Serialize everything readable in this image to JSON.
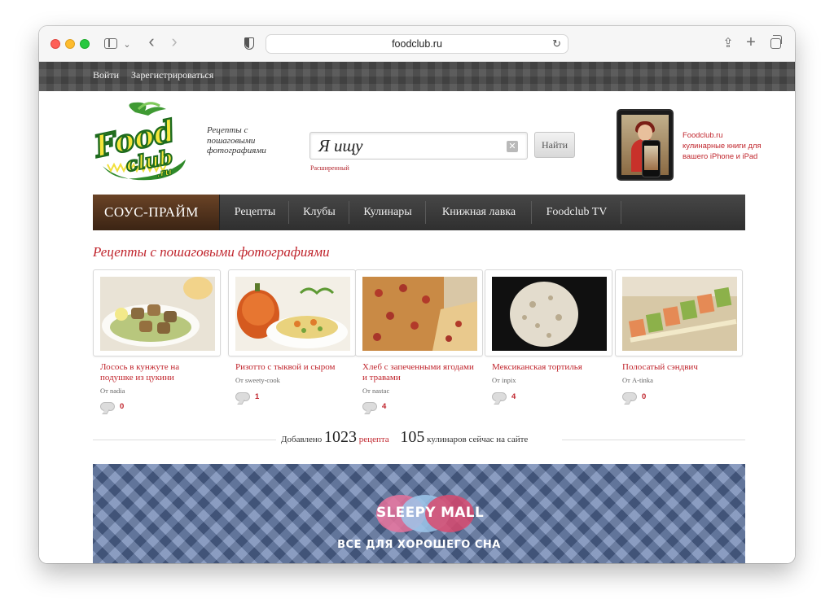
{
  "browser": {
    "url": "foodclub.ru"
  },
  "topbar": {
    "login": "Войти",
    "register": "Зарегистрироваться"
  },
  "header": {
    "tagline": "Рецепты с пошаговыми фотографиями",
    "search_value": "Я ищу",
    "advanced": "Расширенный",
    "find_button": "Найти",
    "promo": "Foodclub.ru кулинарные книги для вашего iPhone и iPad"
  },
  "nav": {
    "brand": "СОУС-ПРАЙМ",
    "items": [
      "Рецепты",
      "Клубы",
      "Кулинары",
      "Книжная лавка",
      "Foodclub TV"
    ]
  },
  "section_title": "Рецепты с пошаговыми фотографиями",
  "recipes": [
    {
      "title": "Лосось в кунжуте на подушке из цукини",
      "author": "От nadia",
      "comments": "0"
    },
    {
      "title": "Ризотто с тыквой и сыром",
      "author": "От sweety-cook",
      "comments": "1"
    },
    {
      "title": "Хлеб с запеченными ягодами и травами",
      "author": "От nastac",
      "comments": "4"
    },
    {
      "title": "Мексиканская тортилья",
      "author": "От inpix",
      "comments": "4"
    },
    {
      "title": "Полосатый сэндвич",
      "author": "От A-tinka",
      "comments": "0"
    }
  ],
  "stats": {
    "added_label": "Добавлено",
    "recipe_count": "1023",
    "recipe_word": "рецепта",
    "online_count": "105",
    "online_label": "кулинаров сейчас на сайте"
  },
  "banner": {
    "brand": "SLEEPY MALL",
    "slogan": "ВСЕ ДЛЯ ХОРОШЕГО СНА"
  },
  "colors": {
    "accent_red": "#c0242c",
    "nav_dark": "#3b3b3b"
  }
}
